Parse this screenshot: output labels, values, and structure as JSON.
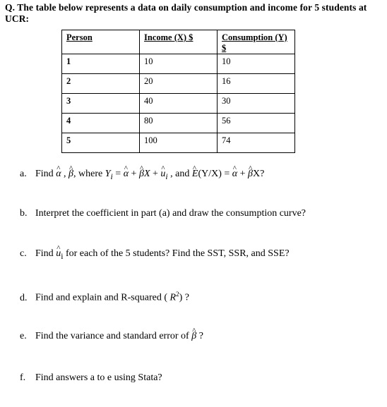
{
  "title": "Q.  The table below represents a data on daily consumption and income for 5 students at UCR:",
  "table": {
    "headers": [
      "Person",
      "Income (X)  $",
      "Consumption (Y)  $"
    ],
    "rows": [
      {
        "person": "1",
        "income": "10",
        "consumption": "10"
      },
      {
        "person": "2",
        "income": "20",
        "consumption": "16"
      },
      {
        "person": "3",
        "income": "40",
        "consumption": "30"
      },
      {
        "person": "4",
        "income": "80",
        "consumption": "56"
      },
      {
        "person": "5",
        "income": "100",
        "consumption": "74"
      }
    ]
  },
  "questions": {
    "a": {
      "label": "a.",
      "text_before": "Find ",
      "alpha": "α",
      "comma1": " , ",
      "beta": "β",
      "where": ", where ",
      "Y": "Y",
      "sub_i": "i",
      "eq1": " = ",
      "plus": " + ",
      "X": "X",
      "u": "u",
      "tail_comma": " ,   and ",
      "E": "E",
      "ye": "(Y/X) = ",
      "end": "X?"
    },
    "b": {
      "label": "b.",
      "text": "Interpret the coefficient in part (a) and draw the consumption curve?"
    },
    "c": {
      "label": "c.",
      "text_before": "Find  ",
      "u": "u",
      "sub_i": "i",
      "text_after": " for each of the 5 students? Find the SST, SSR, and SSE?"
    },
    "d": {
      "label": "d.",
      "text_before": "Find and  explain and R-squared ( ",
      "R": "R",
      "sup": "2",
      "text_after": ") ?"
    },
    "e": {
      "label": "e.",
      "text_before": "Find the variance and standard error of  ",
      "beta": "β",
      "text_after": " ?"
    },
    "f": {
      "label": "f.",
      "text": "Find answers a to e using Stata?"
    }
  }
}
